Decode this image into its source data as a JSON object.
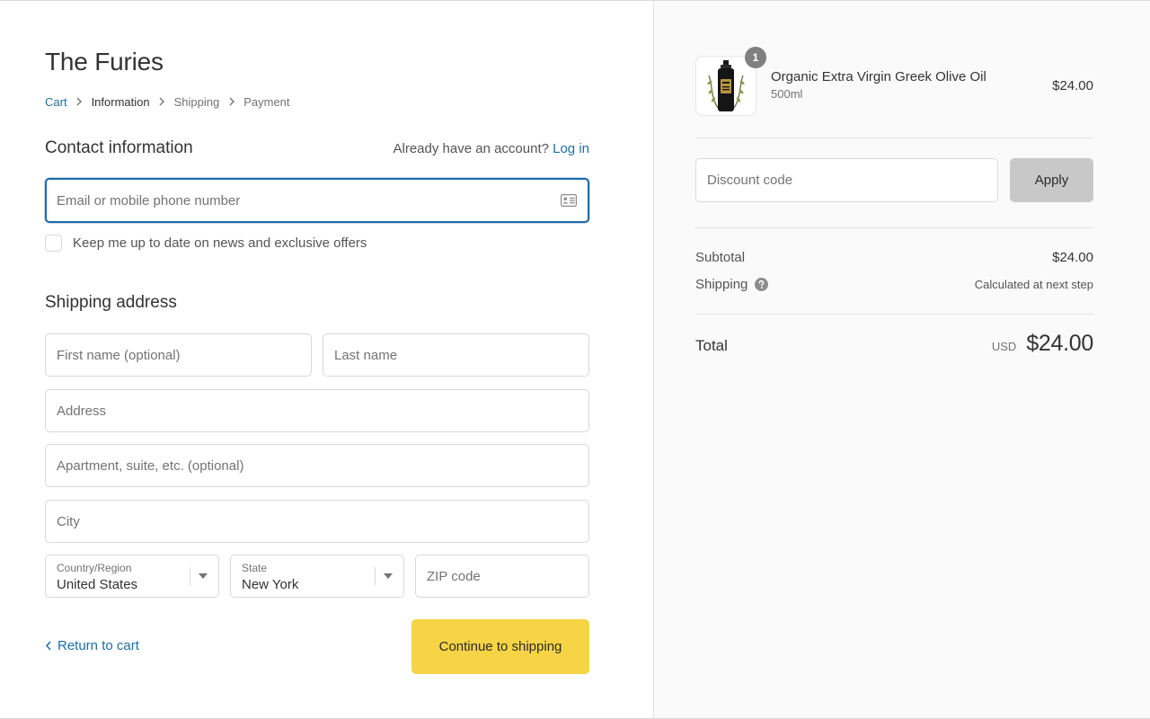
{
  "shop": {
    "title": "The Furies"
  },
  "breadcrumb": [
    {
      "label": "Cart",
      "state": "link"
    },
    {
      "label": "Information",
      "state": "current"
    },
    {
      "label": "Shipping",
      "state": "upcoming"
    },
    {
      "label": "Payment",
      "state": "upcoming"
    }
  ],
  "contact": {
    "title": "Contact information",
    "account_prompt": "Already have an account?",
    "login_label": "Log in",
    "email_placeholder": "Email or mobile phone number",
    "newsletter_label": "Keep me up to date on news and exclusive offers",
    "newsletter_checked": false
  },
  "shipping_address": {
    "title": "Shipping address",
    "first_name_placeholder": "First name (optional)",
    "last_name_placeholder": "Last name",
    "address_placeholder": "Address",
    "apartment_placeholder": "Apartment, suite, etc. (optional)",
    "city_placeholder": "City",
    "country_label": "Country/Region",
    "country_value": "United States",
    "state_label": "State",
    "state_value": "New York",
    "zip_placeholder": "ZIP code"
  },
  "actions": {
    "return_label": "Return to cart",
    "continue_label": "Continue to shipping"
  },
  "order": {
    "product": {
      "name": "Organic Extra Virgin Greek Olive Oil",
      "variant": "500ml",
      "price": "$24.00",
      "quantity": "1"
    },
    "discount_placeholder": "Discount code",
    "apply_label": "Apply",
    "subtotal_label": "Subtotal",
    "subtotal_value": "$24.00",
    "shipping_label": "Shipping",
    "shipping_value": "Calculated at next step",
    "total_label": "Total",
    "currency": "USD",
    "total_value": "$24.00"
  },
  "colors": {
    "accent_link": "#1d6fa5",
    "focus_border": "#1f6aa7",
    "continue_button": "#f6d445",
    "apply_button": "#c8c8c8",
    "sidebar_bg": "#fafafa"
  },
  "icons": {
    "email_field": "contact-card-icon",
    "shipping_help": "question-circle-icon",
    "select_arrow": "caret-down-icon",
    "breadcrumb_separator": "chevron-right-icon",
    "return": "chevron-left-icon"
  }
}
